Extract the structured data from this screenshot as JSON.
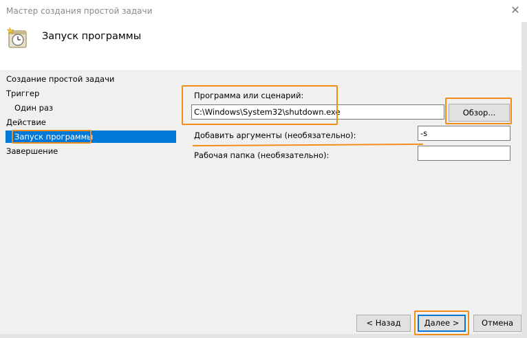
{
  "window": {
    "title": "Мастер создания простой задачи",
    "close_glyph": "✕"
  },
  "header": {
    "title": "Запуск программы",
    "icon": "task-clock-icon"
  },
  "nav": {
    "items": [
      {
        "label": "Создание простой задачи"
      },
      {
        "label": "Триггер"
      },
      {
        "label": "Один раз"
      },
      {
        "label": "Действие"
      },
      {
        "label": "Запуск программы"
      },
      {
        "label": "Завершение"
      }
    ],
    "active_index": 4
  },
  "form": {
    "program_label": "Программа или сценарий:",
    "program_value": "C:\\Windows\\System32\\shutdown.exe",
    "browse_label": "Обзор...",
    "args_label": "Добавить аргументы (необязательно):",
    "args_value": "-s",
    "workdir_label": "Рабочая папка (необязательно):",
    "workdir_value": ""
  },
  "buttons": {
    "back": "< Назад",
    "next": "Далее >",
    "cancel": "Отмена"
  },
  "colors": {
    "accent": "#0078d7",
    "highlight": "#f28c18"
  }
}
